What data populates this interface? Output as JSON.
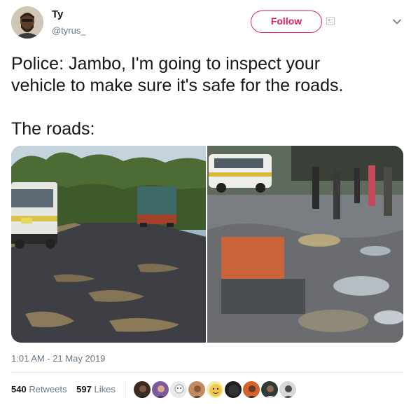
{
  "user": {
    "name": "Ty",
    "handle": "@tyrus_",
    "avatar_icon": "user-avatar-icon"
  },
  "follow_label": "Follow",
  "tweet": {
    "lines": [
      "Police: Jambo, I'm going to inspect your",
      "vehicle to make sure it's safe for the roads."
    ],
    "second_paragraph": "The roads:"
  },
  "media": {
    "left_image_icon": "photo-rural-road-with-matatu-icon",
    "right_image_icon": "photo-potholed-city-street-icon"
  },
  "timestamp": "1:01 AM - 21 May 2019",
  "stats": {
    "retweets_count": "540",
    "retweets_label": "Retweets",
    "likes_count": "597",
    "likes_label": "Likes"
  },
  "likers": [
    {
      "color": "#3b2b22"
    },
    {
      "color": "#7a5b9c"
    },
    {
      "color": "#e9e9e9"
    },
    {
      "color": "#c48b63"
    },
    {
      "color": "#f2c94c"
    },
    {
      "color": "#1f1f1f"
    },
    {
      "color": "#d4622d"
    },
    {
      "color": "#2f3b36"
    },
    {
      "color": "#4a4a4a"
    }
  ],
  "colors": {
    "follow_accent": "#e0245e",
    "secondary_text": "#657786",
    "primary_text": "#14171a"
  }
}
